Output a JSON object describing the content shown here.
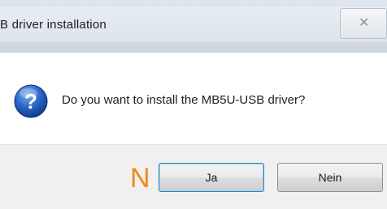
{
  "window": {
    "title": "B driver installation",
    "close_glyph": "✕"
  },
  "dialog": {
    "icon": "question-icon",
    "message": "Do you want to install the MB5U-USB driver?"
  },
  "buttons": {
    "yes_label": "Ja",
    "no_label": "Nein"
  },
  "annotation": {
    "label": "N",
    "color": "#f08a1c"
  },
  "colors": {
    "titlebar": "#d4dbe3",
    "footer": "#f0f0f0",
    "icon_blue": "#1f5fbf",
    "focus_border": "#3c7fb1"
  }
}
